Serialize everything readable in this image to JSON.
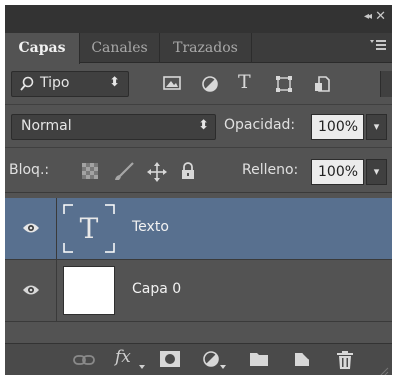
{
  "window": {
    "collapse_glyph": "◂◂",
    "close_glyph": "✕"
  },
  "tabs": [
    {
      "label": "Capas",
      "active": true
    },
    {
      "label": "Canales",
      "active": false
    },
    {
      "label": "Trazados",
      "active": false
    }
  ],
  "panel_menu_glyph": "▾≡",
  "filter": {
    "selected": "Tipo",
    "arrow": "⬍",
    "icons": [
      "image-filter-icon",
      "adjustment-filter-icon",
      "type-filter-icon",
      "shape-filter-icon",
      "smart-object-filter-icon"
    ],
    "type_glyph": "T"
  },
  "blend": {
    "mode": "Normal",
    "arrow": "⬍"
  },
  "opacity": {
    "label": "Opacidad:",
    "value": "100%",
    "arrow": "▾"
  },
  "lock": {
    "label": "Bloq.:",
    "icons": [
      "lock-transparent-pixels-icon",
      "lock-image-pixels-icon",
      "lock-position-icon",
      "lock-all-icon"
    ]
  },
  "fill": {
    "label": "Relleno:",
    "value": "100%",
    "arrow": "▾"
  },
  "layers": [
    {
      "name": "Texto",
      "kind": "text",
      "selected": true,
      "thumb_glyph": "T"
    },
    {
      "name": "Capa 0",
      "kind": "pixel",
      "selected": false
    }
  ],
  "footer": {
    "fx_label": "fx",
    "tools": [
      "link-layers-icon",
      "layer-style-fx-icon",
      "add-mask-icon",
      "new-adjustment-layer-icon",
      "new-group-icon",
      "new-layer-icon",
      "delete-layer-icon"
    ]
  },
  "colors": {
    "panel_bg": "#535353",
    "selected_row": "#58708f",
    "field_bg": "#ececec"
  }
}
